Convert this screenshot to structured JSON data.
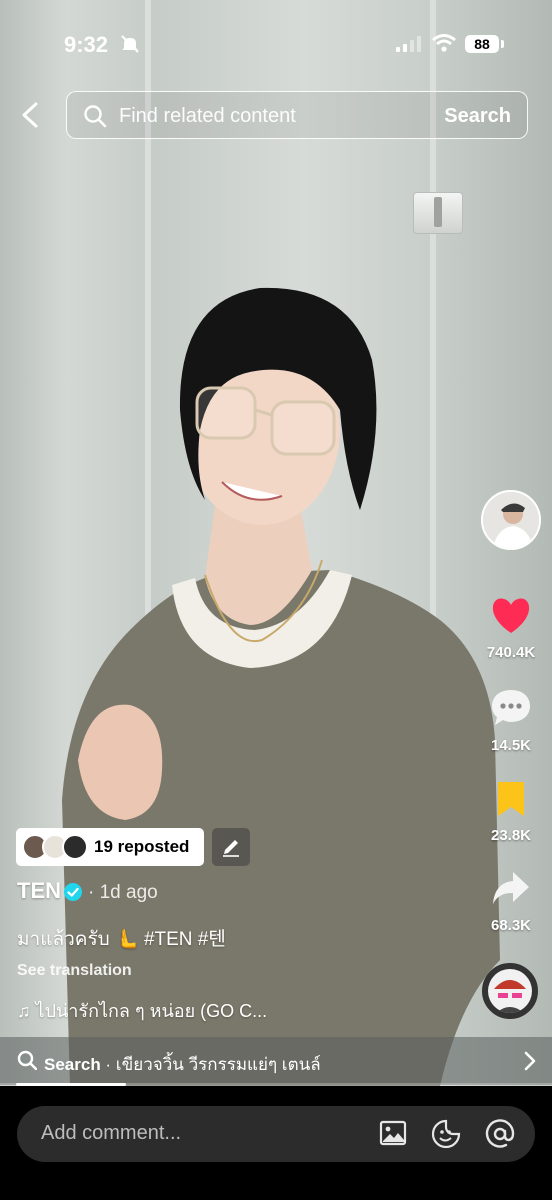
{
  "status_bar": {
    "time": "9:32",
    "battery": "88"
  },
  "search": {
    "placeholder": "Find related content",
    "button": "Search"
  },
  "rail": {
    "likes": "740.4K",
    "comments": "14.5K",
    "saves": "23.8K",
    "shares": "68.3K"
  },
  "reposted": {
    "label": "19 reposted"
  },
  "post": {
    "author": "TEN",
    "age": "· 1d ago",
    "caption": "มาแล้วครับ 🫷 #TEN #텐",
    "see_translation": "See translation",
    "music": "ไปน่ารักไกล ๆ หน่อย (GO C..."
  },
  "suggestion": {
    "label": "Search",
    "query": " · เขียวจวิ้น วีรกรรมแย่ๆ เตนล์"
  },
  "playback": {
    "progress_fraction": 0.2
  },
  "comment_bar": {
    "placeholder": "Add comment..."
  },
  "colors": {
    "like": "#fe2c55",
    "save": "#fcc419",
    "verified": "#20d5ec"
  }
}
